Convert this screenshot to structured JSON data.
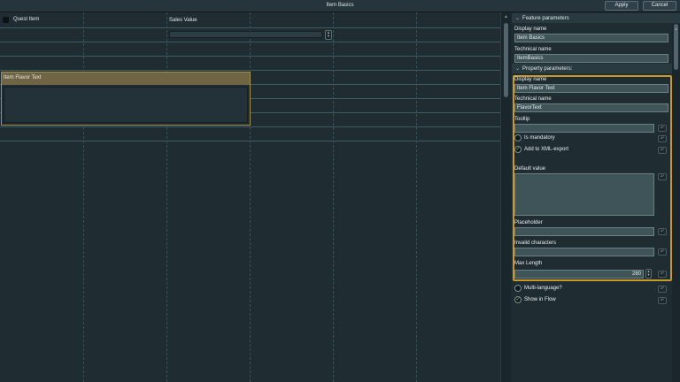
{
  "window": {
    "title": "Item Basics"
  },
  "toolbar": {
    "apply_label": "Apply",
    "cancel_label": "Cancel"
  },
  "canvas": {
    "quest_item_label": "Quest Item",
    "sales_value_label": "Sales Value",
    "flavor_text_label": "Item Flavor Text"
  },
  "panel": {
    "feature_section": "Feature parameters",
    "property_section": "Property parameters:",
    "feature": {
      "display_name_label": "Display name",
      "display_name_value": "Item Basics",
      "technical_name_label": "Technical name",
      "technical_name_value": "ItemBasics"
    },
    "property": {
      "display_name_label": "Display name",
      "display_name_value": "Item Flavor Text",
      "technical_name_label": "Technical name",
      "technical_name_value": "FlavorText",
      "tooltip_label": "Tooltip",
      "tooltip_value": "",
      "is_mandatory_label": "Is mandatory",
      "is_mandatory_checked": false,
      "xml_export_label": "Add to XML-export",
      "xml_export_checked": true,
      "default_value_label": "Default value",
      "placeholder_label": "Placeholder",
      "invalid_chars_label": "Invalid characters",
      "max_length_label": "Max Length",
      "max_length_value": "280"
    },
    "multi_language_label": "Multi-language?",
    "multi_language_checked": false,
    "show_in_flow_label": "Show in Flow",
    "show_in_flow_checked": true
  },
  "icons": {
    "check": "✓",
    "chevron": "❯",
    "reset": "↶",
    "spin_up": "▲",
    "spin_down": "▼"
  },
  "colors": {
    "accent_orange": "#c89a2c",
    "check_green": "#8bc34a",
    "selection_header": "#6f6444"
  }
}
